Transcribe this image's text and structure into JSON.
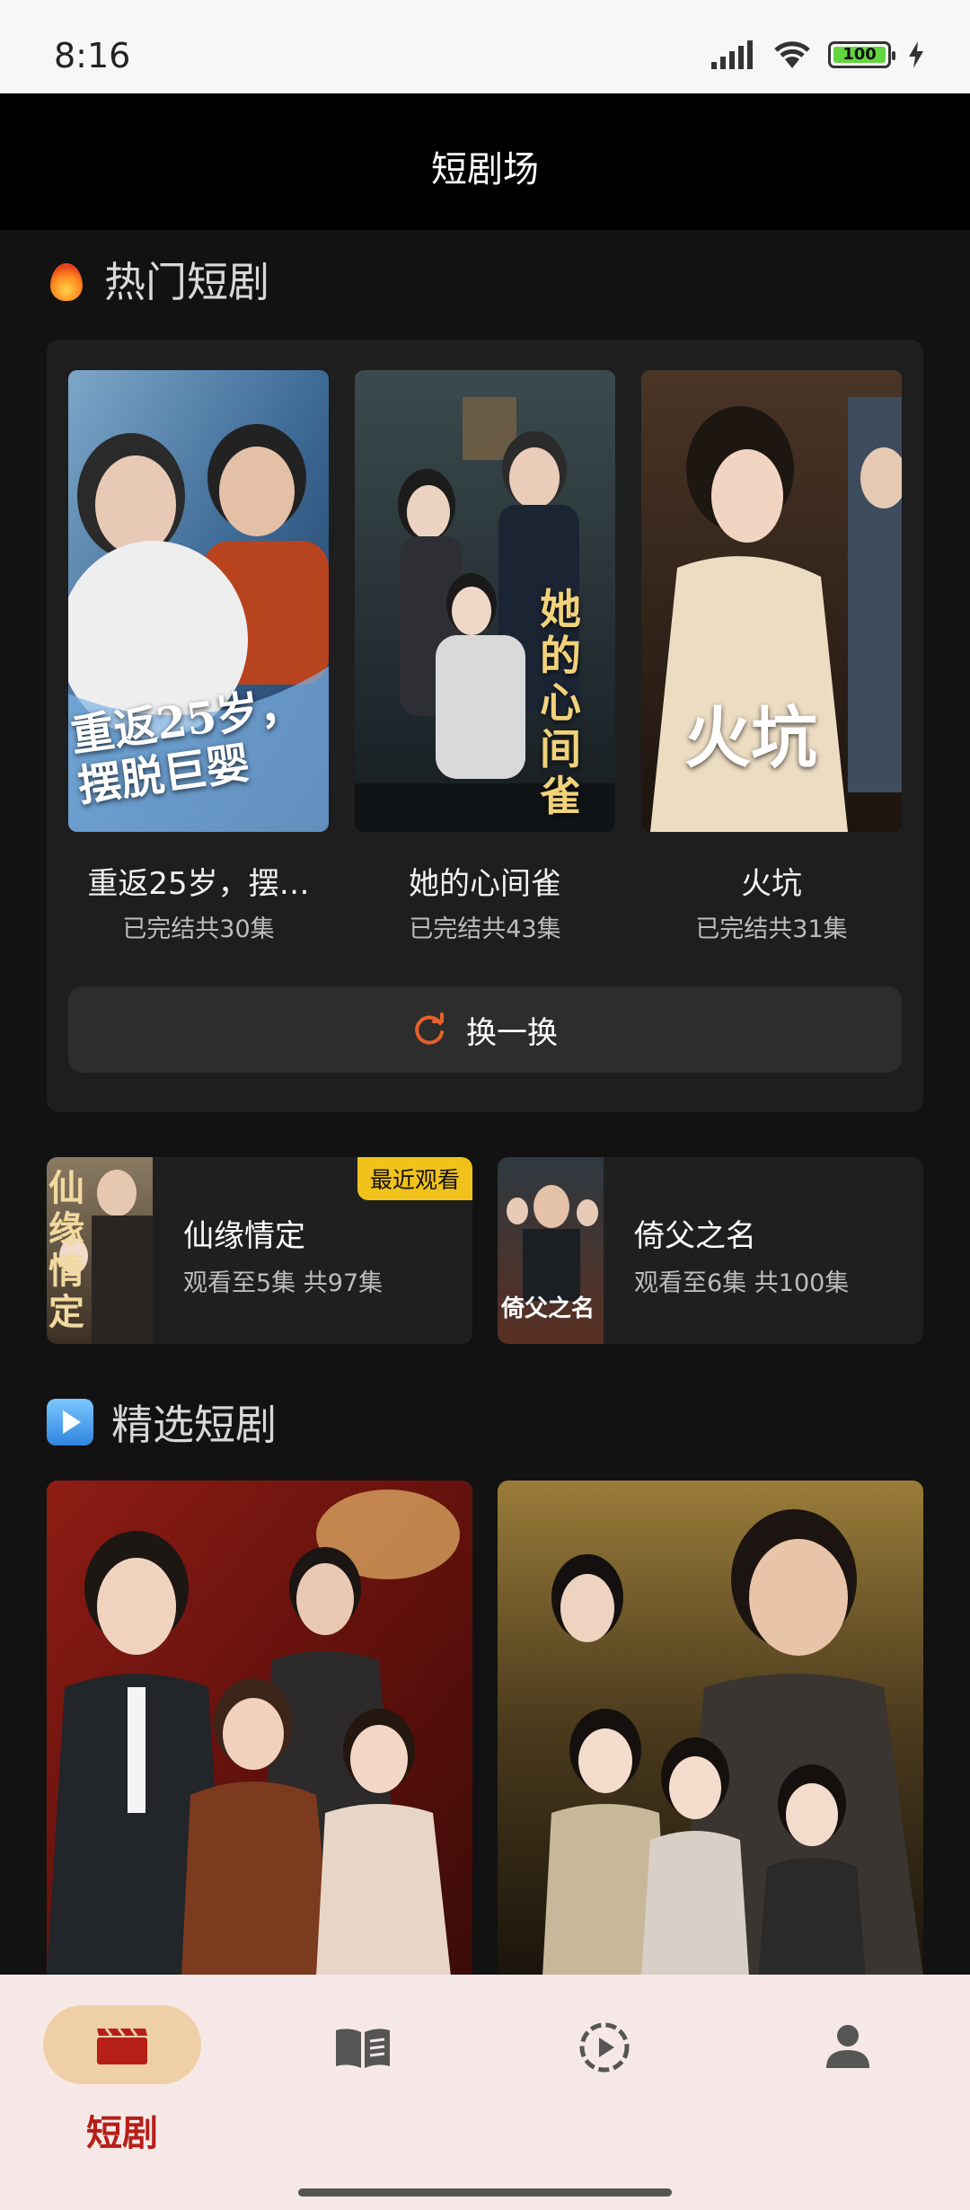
{
  "status": {
    "time": "8:16",
    "battery": "100"
  },
  "header": {
    "title": "短剧场"
  },
  "hot": {
    "title": "热门短剧",
    "items": [
      {
        "name": "重返25岁，摆…",
        "meta": "已完结共30集",
        "poster_text": "重返25岁，摆脱巨婴"
      },
      {
        "name": "她的心间雀",
        "meta": "已完结共43集",
        "poster_text": "她的心间雀"
      },
      {
        "name": "火坑",
        "meta": "已完结共31集",
        "poster_text": "火坑"
      }
    ],
    "swap_label": "换一换"
  },
  "recent": [
    {
      "title": "仙缘情定",
      "progress": "观看至5集 共97集",
      "badge": "最近观看",
      "poster_text": "仙缘情定"
    },
    {
      "title": "倚父之名",
      "progress": "观看至6集 共100集",
      "poster_text": "倚父之名"
    }
  ],
  "featured": {
    "title": "精选短剧"
  },
  "nav": {
    "active_label": "短剧"
  },
  "colors": {
    "accent": "#b51f17",
    "nav_bg": "#f7e8e8",
    "pill": "#efd0a6",
    "badge": "#f0c21b"
  }
}
